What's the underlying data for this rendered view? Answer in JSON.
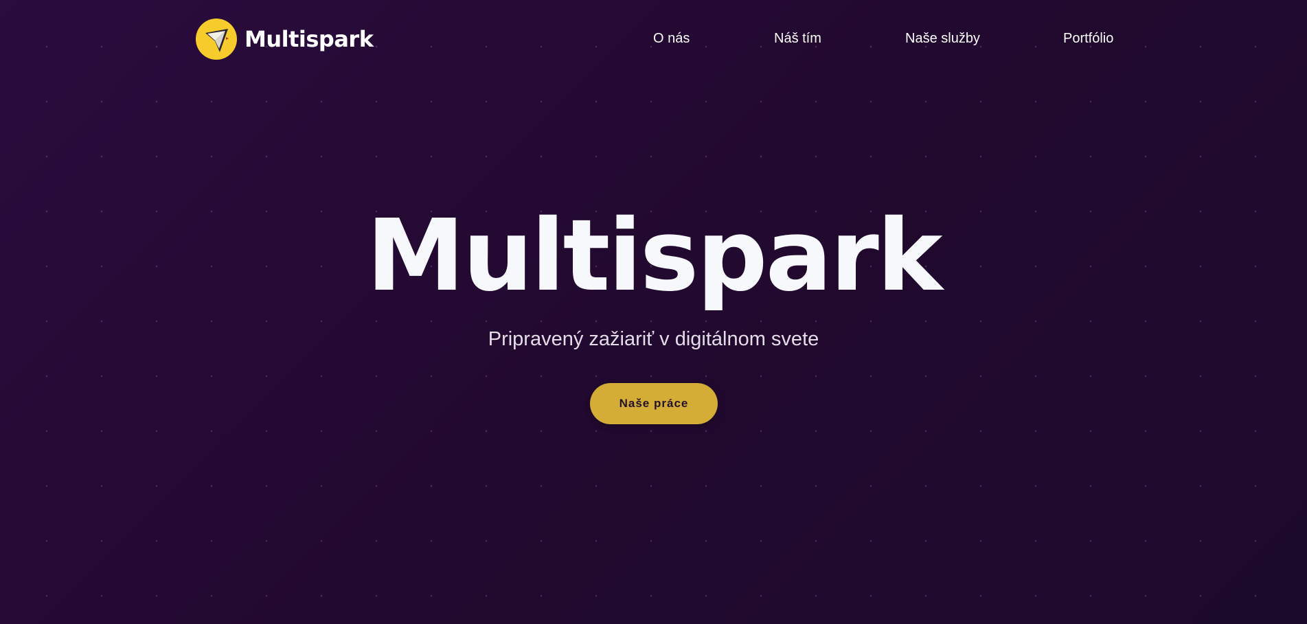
{
  "header": {
    "brand_name": "Multispark",
    "nav": [
      {
        "label": "O nás"
      },
      {
        "label": "Náš tím"
      },
      {
        "label": "Naše služby"
      },
      {
        "label": "Portfólio"
      }
    ]
  },
  "hero": {
    "title": "Multispark",
    "subtitle": "Pripravený zažiariť v digitálnom svete",
    "cta_label": "Naše práce"
  },
  "colors": {
    "background": "#240b33",
    "accent": "#d3ad35",
    "logo_yellow": "#f5cc2b",
    "text": "#f6f8fb"
  },
  "icons": {
    "logo": "paper-plane-icon"
  }
}
